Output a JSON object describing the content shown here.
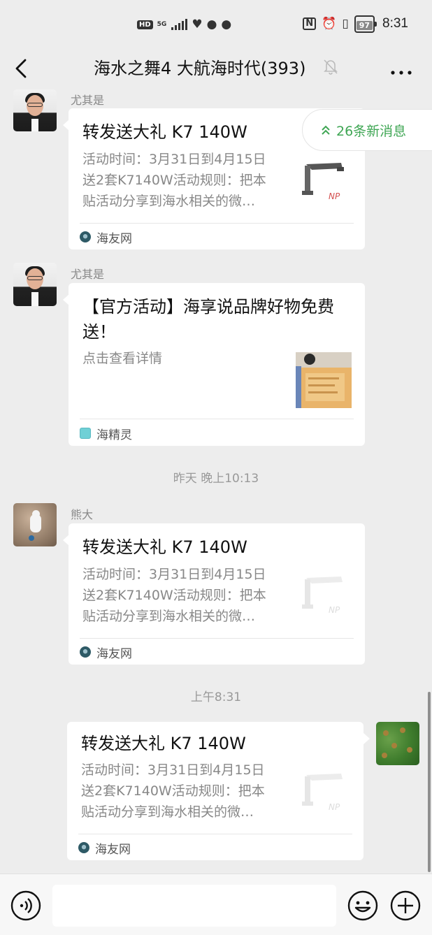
{
  "status_bar": {
    "hd": "HD",
    "network": "5G",
    "nfc": "N",
    "battery": "97",
    "time": "8:31"
  },
  "nav": {
    "title": "海水之舞4 大航海时代(393)"
  },
  "new_messages": {
    "label": "26条新消息"
  },
  "messages": [
    {
      "sender": "尤其是",
      "title": "转发送大礼 K7 140W",
      "desc": [
        "活动时间：3月31日到4月15日",
        "送2套K7140W活动规则：把本",
        "贴活动分享到海水相关的微…"
      ],
      "source": "海友网"
    },
    {
      "sender": "尤其是",
      "title": "【官方活动】海享说品牌好物免费送！",
      "desc": [
        "点击查看详情"
      ],
      "source": "海精灵"
    },
    {
      "timestamp": "昨天 晚上10:13"
    },
    {
      "sender": "熊大",
      "title": "转发送大礼 K7 140W",
      "desc": [
        "活动时间：3月31日到4月15日",
        "送2套K7140W活动规则：把本",
        "贴活动分享到海水相关的微…"
      ],
      "source": "海友网"
    },
    {
      "timestamp": "上午8:31"
    },
    {
      "sender": "",
      "title": "转发送大礼 K7 140W",
      "desc": [
        "活动时间：3月31日到4月15日",
        "送2套K7140W活动规则：把本",
        "贴活动分享到海水相关的微…"
      ],
      "source": "海友网"
    }
  ],
  "thumb_logo": "NP",
  "colors": {
    "background": "#ededed",
    "accent_green": "#3fa654",
    "muted_text": "#888888"
  },
  "icons": [
    "back-icon",
    "mute-bell-icon",
    "more-icon",
    "voice-icon",
    "emoji-icon",
    "plus-icon",
    "double-chevron-up-icon"
  ]
}
